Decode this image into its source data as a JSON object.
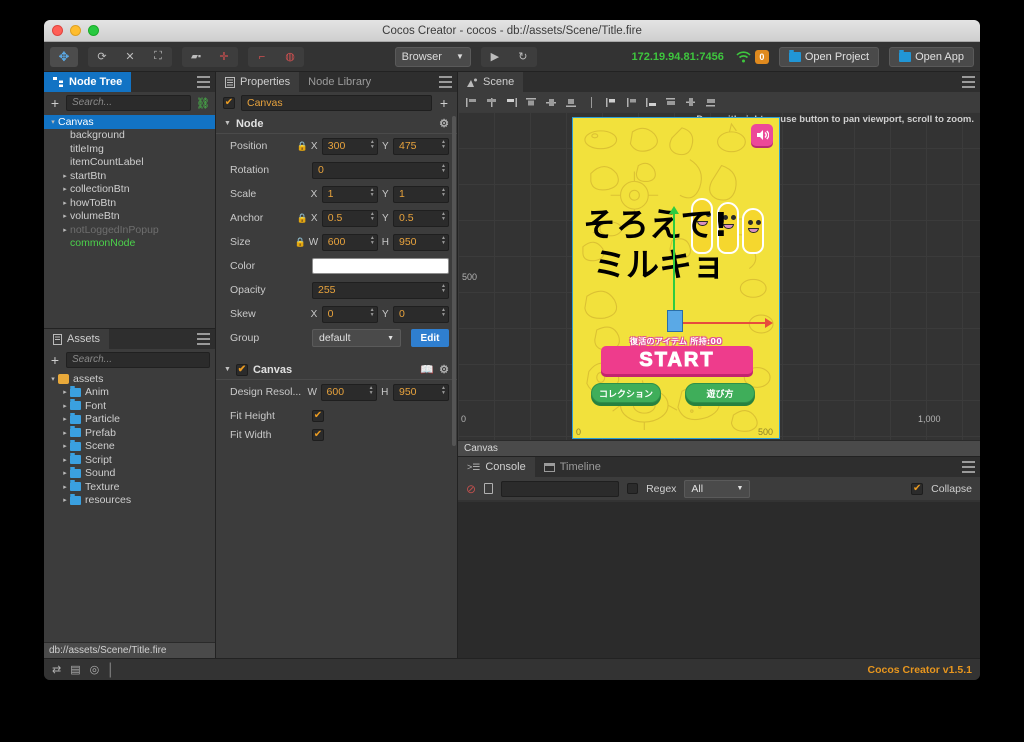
{
  "window": {
    "title": "Cocos Creator - cocos - db://assets/Scene/Title.fire"
  },
  "toolbar": {
    "tools": [
      {
        "name": "move-tool",
        "glyph": "✥"
      },
      {
        "name": "rotate-tool",
        "glyph": "⟳"
      },
      {
        "name": "scale-tool",
        "glyph": "⤧"
      },
      {
        "name": "rect-tool",
        "glyph": "⛶"
      },
      {
        "name": "pivot-tool",
        "glyph": "▣"
      },
      {
        "name": "center-tool",
        "glyph": "✛"
      },
      {
        "name": "local-tool",
        "glyph": "⌐"
      },
      {
        "name": "global-tool",
        "glyph": "◍"
      }
    ],
    "device_label": "Browser",
    "play_glyph": "▶",
    "refresh_glyph": "↻",
    "ip_address": "172.19.94.81:7456",
    "wifi_glyph": "((•))",
    "connection_count": "0",
    "open_project_label": "Open Project",
    "open_app_label": "Open App"
  },
  "node_tree": {
    "tab_label": "Node Tree",
    "search_placeholder": "Search...",
    "add_label": "+",
    "items": [
      {
        "label": "Canvas",
        "depth": 0,
        "arrow": "▾",
        "selected": true,
        "style": "normal"
      },
      {
        "label": "background",
        "depth": 1,
        "arrow": "",
        "selected": false,
        "style": "normal"
      },
      {
        "label": "titleImg",
        "depth": 1,
        "arrow": "",
        "selected": false,
        "style": "normal"
      },
      {
        "label": "itemCountLabel",
        "depth": 1,
        "arrow": "",
        "selected": false,
        "style": "normal"
      },
      {
        "label": "startBtn",
        "depth": 1,
        "arrow": "▸",
        "selected": false,
        "style": "normal"
      },
      {
        "label": "collectionBtn",
        "depth": 1,
        "arrow": "▸",
        "selected": false,
        "style": "normal"
      },
      {
        "label": "howToBtn",
        "depth": 1,
        "arrow": "▸",
        "selected": false,
        "style": "normal"
      },
      {
        "label": "volumeBtn",
        "depth": 1,
        "arrow": "▸",
        "selected": false,
        "style": "normal"
      },
      {
        "label": "notLoggedInPopup",
        "depth": 1,
        "arrow": "▸",
        "selected": false,
        "style": "dim"
      },
      {
        "label": "commonNode",
        "depth": 1,
        "arrow": "",
        "selected": false,
        "style": "green"
      }
    ]
  },
  "assets": {
    "tab_label": "Assets",
    "search_placeholder": "Search...",
    "root_label": "assets",
    "folders": [
      "Anim",
      "Font",
      "Particle",
      "Prefab",
      "Scene",
      "Script",
      "Sound",
      "Texture",
      "resources"
    ],
    "status_path": "db://assets/Scene/Title.fire"
  },
  "properties": {
    "tabs": [
      {
        "label": "Properties",
        "active": true
      },
      {
        "label": "Node Library",
        "active": false
      }
    ],
    "node_name": "Canvas",
    "add_component_label": "+",
    "node_section": {
      "title": "Node"
    },
    "rows": {
      "position": {
        "label": "Position",
        "x_axis": "X",
        "x": "300",
        "y_axis": "Y",
        "y": "475"
      },
      "rotation": {
        "label": "Rotation",
        "value": "0"
      },
      "scale": {
        "label": "Scale",
        "x_axis": "X",
        "x": "1",
        "y_axis": "Y",
        "y": "1"
      },
      "anchor": {
        "label": "Anchor",
        "x_axis": "X",
        "x": "0.5",
        "y_axis": "Y",
        "y": "0.5"
      },
      "size": {
        "label": "Size",
        "x_axis": "W",
        "x": "600",
        "y_axis": "H",
        "y": "950"
      },
      "color": {
        "label": "Color",
        "value": "#FFFFFF"
      },
      "opacity": {
        "label": "Opacity",
        "value": "255"
      },
      "skew": {
        "label": "Skew",
        "x_axis": "X",
        "x": "0",
        "y_axis": "Y",
        "y": "0"
      },
      "group": {
        "label": "Group",
        "value": "default",
        "edit_label": "Edit"
      }
    },
    "canvas_section": {
      "title": "Canvas",
      "design_label": "Design Resol...",
      "w_axis": "W",
      "w": "600",
      "h_axis": "H",
      "h": "950",
      "fit_height_label": "Fit Height",
      "fit_width_label": "Fit Width"
    }
  },
  "scene": {
    "tab_label": "Scene",
    "hint": "Drag with right mouse button to pan viewport, scroll to zoom.",
    "footer_label": "Canvas",
    "ruler_left": "500",
    "ruler_bottom_left": "0",
    "ruler_bottom_mid": "500",
    "ruler_bottom_right": "1,000",
    "canvas_ruler_0": "0",
    "canvas_ruler_500": "500",
    "align_tools": [
      {
        "name": "align-left-icon"
      },
      {
        "name": "align-center-h-icon"
      },
      {
        "name": "align-right-icon"
      },
      {
        "name": "align-top-icon"
      },
      {
        "name": "align-middle-v-icon"
      },
      {
        "name": "align-bottom-icon"
      },
      {
        "name": "separator"
      },
      {
        "name": "distribute-left-icon"
      },
      {
        "name": "distribute-center-icon"
      },
      {
        "name": "distribute-right-icon"
      },
      {
        "name": "distribute-top-icon"
      },
      {
        "name": "distribute-middle-icon"
      },
      {
        "name": "distribute-bottom-icon"
      }
    ]
  },
  "game": {
    "title_line1": "そろえて!",
    "title_line2": "ミルキョ",
    "item_text": "復活のアイテム  所持:00",
    "start_label": "START",
    "collection_label": "コレクション",
    "howto_label": "遊び方",
    "sound_glyph": "🔊",
    "bg_color": "#f2e13c",
    "start_color": "#ee3c8c",
    "button_color": "#3fae5a"
  },
  "console": {
    "tabs": [
      {
        "label": "Console",
        "active": true
      },
      {
        "label": "Timeline",
        "active": false
      }
    ],
    "clear_glyph": "⊘",
    "filter_value": "",
    "regex_label": "Regex",
    "level_value": "All",
    "collapse_label": "Collapse"
  },
  "footer": {
    "icons": [
      {
        "name": "sync-icon",
        "glyph": "⇄"
      },
      {
        "name": "database-icon",
        "glyph": "▤"
      },
      {
        "name": "eye-off-icon",
        "glyph": "◎"
      }
    ],
    "version": "Cocos Creator v1.5.1"
  }
}
